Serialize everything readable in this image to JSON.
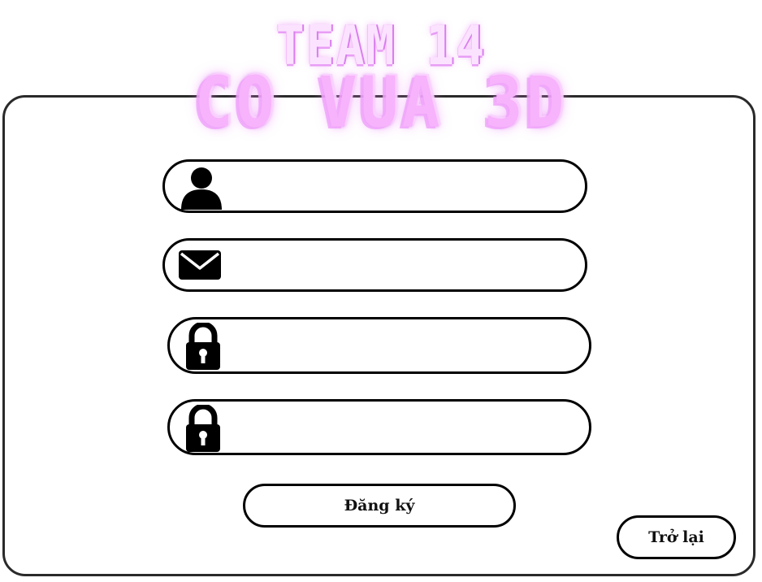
{
  "header": {
    "team_label": "TEAM 14",
    "game_title": "CO VUA 3D",
    "title_color": "#f7b5fa"
  },
  "form": {
    "fields": [
      {
        "icon": "user-icon",
        "value": "",
        "placeholder": ""
      },
      {
        "icon": "mail-icon",
        "value": "",
        "placeholder": ""
      },
      {
        "icon": "lock-icon",
        "value": "",
        "placeholder": ""
      },
      {
        "icon": "lock-icon",
        "value": "",
        "placeholder": ""
      }
    ],
    "register_label": "Đăng ký",
    "back_label": "Trở lại"
  }
}
